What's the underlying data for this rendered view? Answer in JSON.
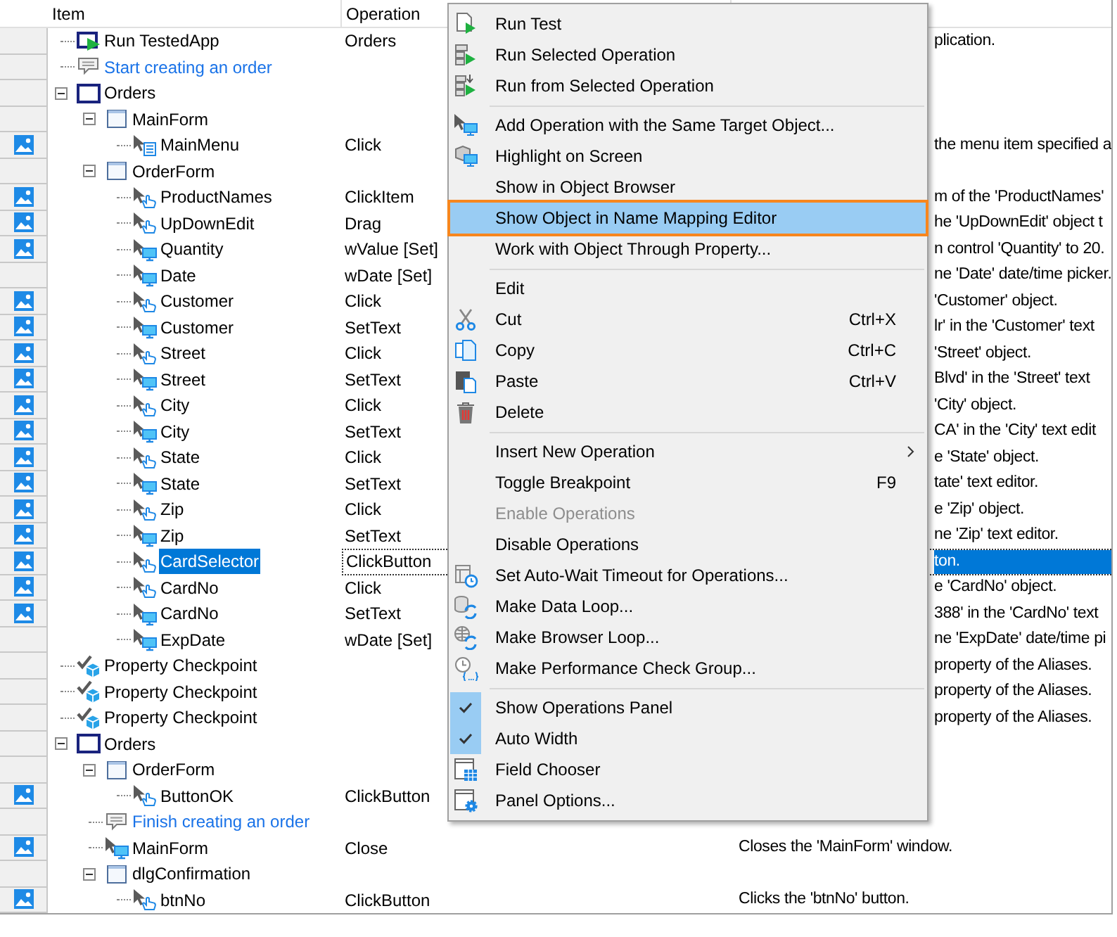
{
  "columns": [
    {
      "label": "Item"
    },
    {
      "label": "Operation"
    }
  ],
  "tree": [
    {
      "label": "Run TestedApp",
      "kind": "run",
      "operation": "Orders",
      "description": "plication.",
      "screenshot": false,
      "selected": false
    },
    {
      "label": "Start creating an order",
      "kind": "comment",
      "screenshot": false,
      "selected": false
    },
    {
      "label": "Orders",
      "kind": "window",
      "expanded": true,
      "screenshot": false,
      "selected": false,
      "children": [
        {
          "label": "MainForm",
          "kind": "form",
          "expanded": true,
          "screenshot": false,
          "selected": false,
          "children": [
            {
              "label": "MainMenu",
              "kind": "menu",
              "operation": "Click",
              "description": "the menu item specified a",
              "screenshot": true,
              "selected": false
            }
          ]
        },
        {
          "label": "OrderForm",
          "kind": "form",
          "expanded": true,
          "screenshot": false,
          "selected": false,
          "children": [
            {
              "label": "ProductNames",
              "kind": "click",
              "operation": "ClickItem",
              "description": "m of the 'ProductNames'",
              "screenshot": true,
              "selected": false
            },
            {
              "label": "UpDownEdit",
              "kind": "click",
              "operation": "Drag",
              "description": "he 'UpDownEdit' object t",
              "screenshot": true,
              "selected": false
            },
            {
              "label": "Quantity",
              "kind": "edit",
              "operation": "wValue [Set]",
              "description": "n control 'Quantity' to 20.",
              "screenshot": true,
              "selected": false
            },
            {
              "label": "Date",
              "kind": "edit",
              "operation": "wDate [Set]",
              "description": "ne 'Date' date/time picker.",
              "screenshot": false,
              "selected": false
            },
            {
              "label": "Customer",
              "kind": "click",
              "operation": "Click",
              "description": "'Customer' object.",
              "screenshot": true,
              "selected": false
            },
            {
              "label": "Customer",
              "kind": "edit",
              "operation": "SetText",
              "description": "lr' in the 'Customer' text",
              "screenshot": true,
              "selected": false
            },
            {
              "label": "Street",
              "kind": "click",
              "operation": "Click",
              "description": "'Street' object.",
              "screenshot": true,
              "selected": false
            },
            {
              "label": "Street",
              "kind": "edit",
              "operation": "SetText",
              "description": "Blvd' in the 'Street' text",
              "screenshot": true,
              "selected": false
            },
            {
              "label": "City",
              "kind": "click",
              "operation": "Click",
              "description": "'City' object.",
              "screenshot": true,
              "selected": false
            },
            {
              "label": "City",
              "kind": "edit",
              "operation": "SetText",
              "description": "CA' in the 'City' text edit",
              "screenshot": true,
              "selected": false
            },
            {
              "label": "State",
              "kind": "click",
              "operation": "Click",
              "description": "e 'State' object.",
              "screenshot": true,
              "selected": false
            },
            {
              "label": "State",
              "kind": "edit",
              "operation": "SetText",
              "description": "tate' text editor.",
              "screenshot": true,
              "selected": false
            },
            {
              "label": "Zip",
              "kind": "click",
              "operation": "Click",
              "description": "e 'Zip' object.",
              "screenshot": true,
              "selected": false
            },
            {
              "label": "Zip",
              "kind": "edit",
              "operation": "SetText",
              "description": "ne 'Zip' text editor.",
              "screenshot": true,
              "selected": false
            },
            {
              "label": "CardSelector",
              "kind": "click",
              "operation": "ClickButton",
              "description": "ton.",
              "screenshot": true,
              "selected": true
            },
            {
              "label": "CardNo",
              "kind": "click",
              "operation": "Click",
              "description": "e 'CardNo' object.",
              "screenshot": true,
              "selected": false
            },
            {
              "label": "CardNo",
              "kind": "edit",
              "operation": "SetText",
              "description": "388' in the 'CardNo' text",
              "screenshot": true,
              "selected": false
            },
            {
              "label": "ExpDate",
              "kind": "edit",
              "operation": "wDate [Set]",
              "description": "ne 'ExpDate' date/time pi",
              "screenshot": false,
              "selected": false
            }
          ]
        }
      ]
    },
    {
      "label": "Property Checkpoint",
      "kind": "checkpoint",
      "description": "property of the Aliases.",
      "screenshot": false,
      "selected": false
    },
    {
      "label": "Property Checkpoint",
      "kind": "checkpoint",
      "description": "property of the Aliases.",
      "screenshot": false,
      "selected": false
    },
    {
      "label": "Property Checkpoint",
      "kind": "checkpoint",
      "description": "property of the Aliases.",
      "screenshot": false,
      "selected": false
    },
    {
      "label": "Orders",
      "kind": "window",
      "expanded": true,
      "screenshot": false,
      "selected": false,
      "children": [
        {
          "label": "OrderForm",
          "kind": "form",
          "expanded": true,
          "screenshot": false,
          "selected": false,
          "children": [
            {
              "label": "ButtonOK",
              "kind": "click",
              "operation": "ClickButton",
              "screenshot": true,
              "selected": false
            }
          ]
        },
        {
          "label": "Finish creating an order",
          "kind": "comment",
          "screenshot": false,
          "selected": false
        },
        {
          "label": "MainForm",
          "kind": "edit",
          "operation": "Close",
          "description": "Closes the 'MainForm' window.",
          "screenshot": true,
          "selected": false
        },
        {
          "label": "dlgConfirmation",
          "kind": "form",
          "expanded": true,
          "screenshot": false,
          "selected": false,
          "children": [
            {
              "label": "btnNo",
              "kind": "click",
              "operation": "ClickButton",
              "description": "Clicks the 'btnNo' button.",
              "screenshot": true,
              "selected": false
            }
          ]
        }
      ]
    }
  ],
  "menu": {
    "items": [
      {
        "kind": "run-test",
        "label": "Run Test",
        "selected": false,
        "checked": false,
        "disabled": false,
        "submenu": false
      },
      {
        "kind": "run-selected",
        "label": "Run Selected Operation",
        "selected": false,
        "checked": false,
        "disabled": false,
        "submenu": false
      },
      {
        "kind": "run-from",
        "label": "Run from Selected Operation",
        "selected": false,
        "checked": false,
        "disabled": false,
        "submenu": false
      },
      {
        "kind": "separator"
      },
      {
        "kind": "add-operation",
        "label": "Add Operation with the Same Target Object...",
        "selected": false,
        "checked": false,
        "disabled": false,
        "submenu": false
      },
      {
        "kind": "highlight",
        "label": "Highlight on Screen",
        "selected": false,
        "checked": false,
        "disabled": false,
        "submenu": false
      },
      {
        "kind": "plain",
        "label": "Show in Object Browser",
        "selected": false,
        "checked": false,
        "disabled": false,
        "submenu": false
      },
      {
        "kind": "plain",
        "label": "Show Object in Name Mapping Editor",
        "selected": true,
        "checked": false,
        "disabled": false,
        "submenu": false
      },
      {
        "kind": "plain",
        "label": "Work with Object Through Property...",
        "selected": false,
        "checked": false,
        "disabled": false,
        "submenu": false
      },
      {
        "kind": "separator"
      },
      {
        "kind": "plain",
        "label": "Edit",
        "selected": false,
        "checked": false,
        "disabled": false,
        "submenu": false
      },
      {
        "kind": "cut",
        "label": "Cut",
        "shortcut": "Ctrl+X",
        "selected": false,
        "checked": false,
        "disabled": false,
        "submenu": false
      },
      {
        "kind": "copy",
        "label": "Copy",
        "shortcut": "Ctrl+C",
        "selected": false,
        "checked": false,
        "disabled": false,
        "submenu": false
      },
      {
        "kind": "paste",
        "label": "Paste",
        "shortcut": "Ctrl+V",
        "selected": false,
        "checked": false,
        "disabled": false,
        "submenu": false
      },
      {
        "kind": "delete",
        "label": "Delete",
        "selected": false,
        "checked": false,
        "disabled": false,
        "submenu": false
      },
      {
        "kind": "separator"
      },
      {
        "kind": "plain",
        "label": "Insert New Operation",
        "selected": false,
        "checked": false,
        "disabled": false,
        "submenu": true
      },
      {
        "kind": "plain",
        "label": "Toggle Breakpoint",
        "shortcut": "F9",
        "selected": false,
        "checked": false,
        "disabled": false,
        "submenu": false
      },
      {
        "kind": "plain",
        "label": "Enable Operations",
        "selected": false,
        "checked": false,
        "disabled": true,
        "submenu": false
      },
      {
        "kind": "plain",
        "label": "Disable Operations",
        "selected": false,
        "checked": false,
        "disabled": false,
        "submenu": false
      },
      {
        "kind": "auto-wait",
        "label": "Set Auto-Wait Timeout for Operations...",
        "selected": false,
        "checked": false,
        "disabled": false,
        "submenu": false
      },
      {
        "kind": "data-loop",
        "label": "Make Data Loop...",
        "selected": false,
        "checked": false,
        "disabled": false,
        "submenu": false
      },
      {
        "kind": "browser-loop",
        "label": "Make Browser Loop...",
        "selected": false,
        "checked": false,
        "disabled": false,
        "submenu": false
      },
      {
        "kind": "perf-group",
        "label": "Make Performance Check Group...",
        "selected": false,
        "checked": false,
        "disabled": false,
        "submenu": false
      },
      {
        "kind": "separator"
      },
      {
        "kind": "plain",
        "label": "Show Operations Panel",
        "selected": false,
        "checked": true,
        "disabled": false,
        "submenu": false
      },
      {
        "kind": "plain",
        "label": "Auto Width",
        "selected": false,
        "checked": true,
        "disabled": false,
        "submenu": false
      },
      {
        "kind": "field-chooser",
        "label": "Field Chooser",
        "selected": false,
        "checked": false,
        "disabled": false,
        "submenu": false
      },
      {
        "kind": "panel-options",
        "label": "Panel Options...",
        "selected": false,
        "checked": false,
        "disabled": false,
        "submenu": false
      }
    ]
  }
}
